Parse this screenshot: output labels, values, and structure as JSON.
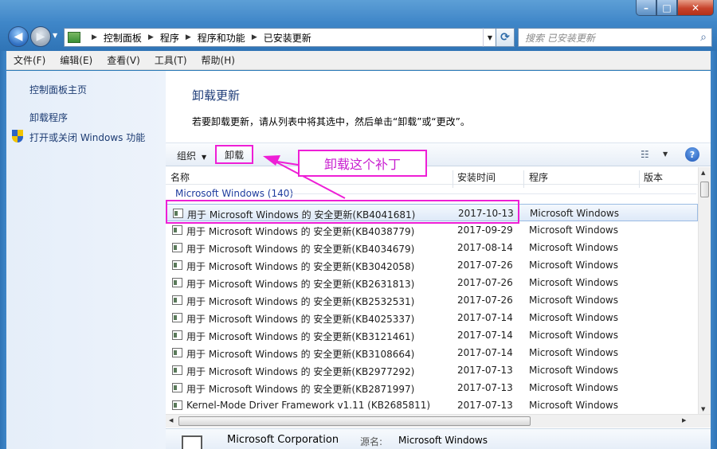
{
  "window": {
    "controls": {
      "min": "–",
      "max": "□",
      "close": "✕"
    }
  },
  "address": {
    "crumbs": [
      "控制面板",
      "程序",
      "程序和功能",
      "已安装更新"
    ],
    "search_placeholder": "搜索 已安装更新"
  },
  "menu": [
    "文件(F)",
    "编辑(E)",
    "查看(V)",
    "工具(T)",
    "帮助(H)"
  ],
  "sidebar": {
    "home": "控制面板主页",
    "uninstall_program": "卸载程序",
    "windows_features": "打开或关闭 Windows 功能"
  },
  "main": {
    "title": "卸载更新",
    "description": "若要卸载更新，请从列表中将其选中，然后单击“卸载”或“更改”。"
  },
  "toolbar": {
    "organize": "组织",
    "uninstall": "卸载",
    "help": "?"
  },
  "annotation": {
    "text": "卸载这个补丁",
    "color": "#ee1fd6"
  },
  "columns": {
    "name": "名称",
    "date": "安装时间",
    "program": "程序",
    "version": "版本"
  },
  "group": "Microsoft Windows (140)",
  "updates": [
    {
      "name": "用于 Microsoft Windows 的 安全更新(KB4041681)",
      "date": "2017-10-13",
      "program": "Microsoft Windows",
      "selected": true
    },
    {
      "name": "用于 Microsoft Windows 的 安全更新(KB4038779)",
      "date": "2017-09-29",
      "program": "Microsoft Windows"
    },
    {
      "name": "用于 Microsoft Windows 的 安全更新(KB4034679)",
      "date": "2017-08-14",
      "program": "Microsoft Windows"
    },
    {
      "name": "用于 Microsoft Windows 的 安全更新(KB3042058)",
      "date": "2017-07-26",
      "program": "Microsoft Windows"
    },
    {
      "name": "用于 Microsoft Windows 的 安全更新(KB2631813)",
      "date": "2017-07-26",
      "program": "Microsoft Windows"
    },
    {
      "name": "用于 Microsoft Windows 的 安全更新(KB2532531)",
      "date": "2017-07-26",
      "program": "Microsoft Windows"
    },
    {
      "name": "用于 Microsoft Windows 的 安全更新(KB4025337)",
      "date": "2017-07-14",
      "program": "Microsoft Windows"
    },
    {
      "name": "用于 Microsoft Windows 的 安全更新(KB3121461)",
      "date": "2017-07-14",
      "program": "Microsoft Windows"
    },
    {
      "name": "用于 Microsoft Windows 的 安全更新(KB3108664)",
      "date": "2017-07-14",
      "program": "Microsoft Windows"
    },
    {
      "name": "用于 Microsoft Windows 的 安全更新(KB2977292)",
      "date": "2017-07-13",
      "program": "Microsoft Windows"
    },
    {
      "name": "用于 Microsoft Windows 的 安全更新(KB2871997)",
      "date": "2017-07-13",
      "program": "Microsoft Windows"
    },
    {
      "name": "Kernel-Mode Driver Framework v1.11 (KB2685811)",
      "date": "2017-07-13",
      "program": "Microsoft Windows"
    }
  ],
  "details": {
    "publisher": "Microsoft Corporation",
    "source_label": "源名:",
    "source_value": "Microsoft Windows"
  }
}
